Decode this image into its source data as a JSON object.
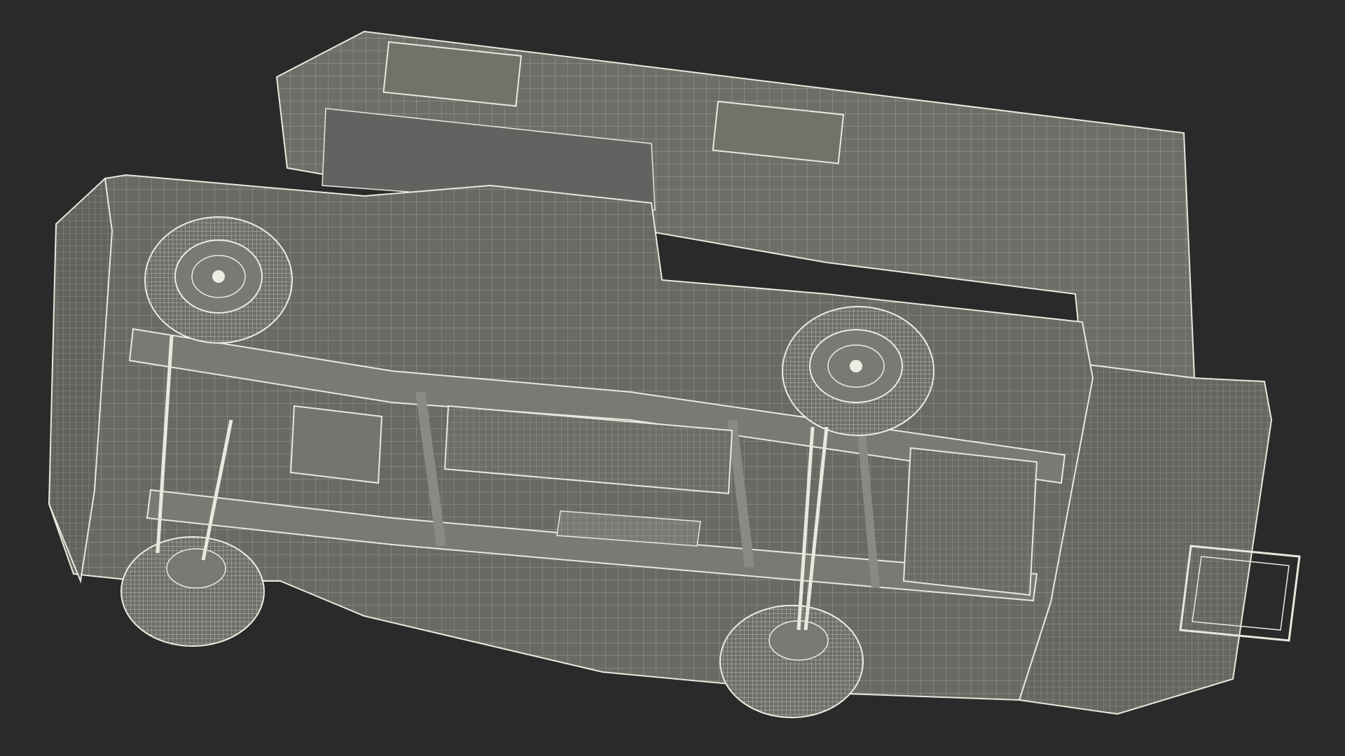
{
  "scene": {
    "subject": "",
    "background_color": "#2a2a2a",
    "body_fill": "#6f6f6a",
    "body_fill_dark": "#5c5c57",
    "wire_color": "#e8e8de",
    "wire_color_dim": "#bdbdb2"
  }
}
